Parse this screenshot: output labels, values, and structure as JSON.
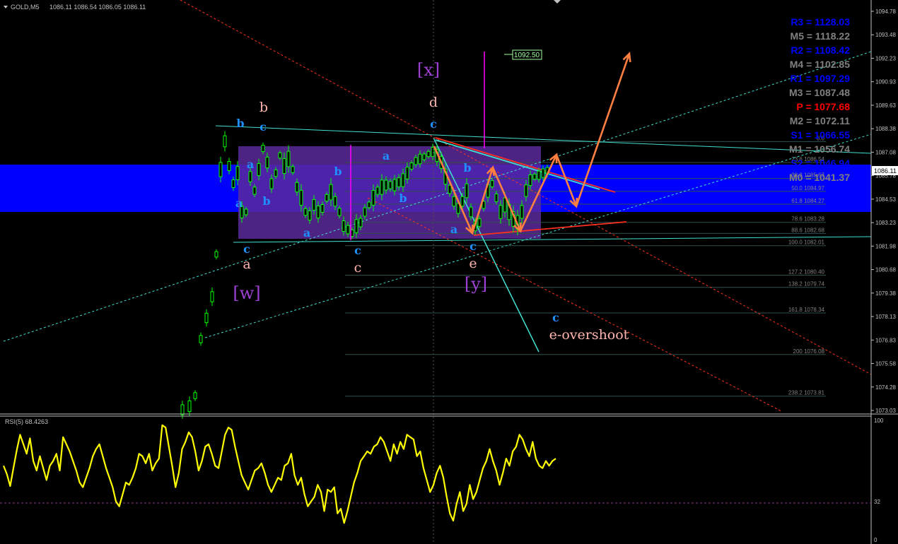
{
  "header": {
    "symbol_label": "GOLD,M5",
    "ohlc": "1086.11 1086.54 1086.05 1086.11"
  },
  "colors": {
    "background": "#000000",
    "axis": "#c0c0c0",
    "grid": "#303030",
    "up_candle": "#00ff00",
    "blue_zone": "#0000ff",
    "purple_box": "#5a2a9a",
    "rsi_line": "#ffff00",
    "rsi_level": "#8b3a8b",
    "fib_line": "#2f4f4f",
    "fib_label": "#808080",
    "wave_blue": "#1e90ff",
    "wave_pink": "#ffb6b0",
    "wave_purple": "#9b40d0",
    "arrow_orange": "#ff7f40",
    "magenta": "#ff00ff",
    "trend_cyan": "#40e0d0",
    "trend_red": "#ff3020"
  },
  "price_axis": {
    "min": 1073.03,
    "max": 1094.78,
    "ticks": [
      "1094.78",
      "1093.48",
      "1092.23",
      "1090.93",
      "1089.63",
      "1088.38",
      "1087.08",
      "1085.78",
      "1084.53",
      "1083.23",
      "1081.98",
      "1080.68",
      "1079.38",
      "1078.13",
      "1076.83",
      "1075.58",
      "1074.28",
      "1073.03"
    ],
    "current_price": "1086.11",
    "marker_price": "1092.50"
  },
  "pivots": [
    {
      "label": "R3 = 1128.03",
      "color": "#0000ff",
      "price": 1128.03
    },
    {
      "label": "M5 = 1118.22",
      "color": "#808080",
      "price": 1118.22
    },
    {
      "label": "R2 = 1108.42",
      "color": "#0000ff",
      "price": 1108.42
    },
    {
      "label": "M4 = 1102.85",
      "color": "#808080",
      "price": 1102.85
    },
    {
      "label": "R1 = 1097.29",
      "color": "#0000ff",
      "price": 1097.29
    },
    {
      "label": "M3 = 1087.48",
      "color": "#808080",
      "price": 1087.48
    },
    {
      "label": "P = 1077.68",
      "color": "#ff0000",
      "price": 1077.68
    },
    {
      "label": "M2 = 1072.11",
      "color": "#808080",
      "price": 1072.11
    },
    {
      "label": "S1 = 1066.55",
      "color": "#0000ff",
      "price": 1066.55
    },
    {
      "label": "M1 = 1056.74",
      "color": "#808080",
      "price": 1056.74
    },
    {
      "label": "S2 = 1046.94",
      "color": "#0000ff",
      "price": 1046.94
    },
    {
      "label": "M0 = 1041.37",
      "color": "#808080",
      "price": 1041.37
    }
  ],
  "fib_levels": [
    {
      "label": "0.0",
      "price": 1087.68
    },
    {
      "label": "23.6 1086.54",
      "price": 1086.54
    },
    {
      "label": "38.2 1085.67",
      "price": 1085.67
    },
    {
      "label": "50.0 1084.97",
      "price": 1084.97
    },
    {
      "label": "61.8 1084.27",
      "price": 1084.27
    },
    {
      "label": "78.6 1083.28",
      "price": 1083.28
    },
    {
      "label": "88.6 1082.68",
      "price": 1082.68
    },
    {
      "label": "100.0 1082.01",
      "price": 1082.01
    },
    {
      "label": "127.2 1080.40",
      "price": 1080.4
    },
    {
      "label": "138.2 1079.74",
      "price": 1079.74
    },
    {
      "label": "161.8 1078.34",
      "price": 1078.34
    },
    {
      "label": "200 1076.08",
      "price": 1076.08
    },
    {
      "label": "238.2 1073.81",
      "price": 1073.81
    }
  ],
  "rsi": {
    "label": "RSI(5) 68.4263",
    "ticks": [
      "100",
      "32",
      "0"
    ],
    "level": 32,
    "values": [
      62,
      55,
      45,
      60,
      75,
      88,
      80,
      72,
      85,
      66,
      58,
      70,
      60,
      50,
      62,
      66,
      72,
      58,
      86,
      80,
      74,
      66,
      58,
      48,
      44,
      52,
      60,
      70,
      76,
      80,
      70,
      60,
      52,
      44,
      32,
      28,
      38,
      48,
      46,
      52,
      60,
      72,
      70,
      64,
      72,
      58,
      64,
      68,
      96,
      94,
      78,
      62,
      44,
      56,
      76,
      82,
      90,
      86,
      74,
      58,
      66,
      78,
      80,
      72,
      62,
      60,
      74,
      88,
      94,
      92,
      78,
      66,
      54,
      48,
      42,
      50,
      58,
      60,
      64,
      56,
      46,
      40,
      46,
      52,
      50,
      62,
      64,
      72,
      54,
      46,
      52,
      38,
      28,
      32,
      36,
      46,
      40,
      24,
      42,
      40,
      44,
      22,
      26,
      14,
      24,
      36,
      48,
      56,
      66,
      70,
      74,
      72,
      78,
      80,
      86,
      82,
      74,
      66,
      80,
      72,
      82,
      76,
      88,
      86,
      84,
      70,
      74,
      60,
      50,
      40,
      46,
      56,
      62,
      52,
      36,
      22,
      16,
      30,
      40,
      24,
      30,
      46,
      34,
      40,
      50,
      60,
      66,
      76,
      66,
      58,
      46,
      56,
      68,
      62,
      74,
      78,
      88,
      84,
      76,
      70,
      82,
      68,
      62,
      60,
      66,
      62,
      66,
      68
    ],
    "last_value": 68.4263
  },
  "wave_labels": [
    {
      "text": "b",
      "class": "blue",
      "pos": [
        340,
        180
      ]
    },
    {
      "text": "c",
      "class": "blue",
      "pos": [
        372,
        185
      ]
    },
    {
      "text": "b",
      "class": "pink",
      "pos": [
        373,
        158
      ]
    },
    {
      "text": "a",
      "class": "blue",
      "pos": [
        354,
        238
      ]
    },
    {
      "text": "a",
      "class": "blue",
      "pos": [
        338,
        293
      ]
    },
    {
      "text": "b",
      "class": "blue",
      "pos": [
        377,
        290
      ]
    },
    {
      "text": "c",
      "class": "blue",
      "pos": [
        349,
        358
      ]
    },
    {
      "text": "a",
      "class": "pink",
      "pos": [
        349,
        380
      ]
    },
    {
      "text": "[w]",
      "class": "purple",
      "pos": [
        349,
        423
      ]
    },
    {
      "text": "a",
      "class": "blue",
      "pos": [
        434,
        335
      ]
    },
    {
      "text": "b",
      "class": "blue",
      "pos": [
        478,
        248
      ]
    },
    {
      "text": "c",
      "class": "blue",
      "pos": [
        506,
        360
      ]
    },
    {
      "text": "c",
      "class": "pink",
      "pos": [
        506,
        385
      ]
    },
    {
      "text": "a",
      "class": "blue",
      "pos": [
        546,
        226
      ]
    },
    {
      "text": "b",
      "class": "blue",
      "pos": [
        570,
        286
      ]
    },
    {
      "text": "[x]",
      "class": "purple",
      "pos": [
        606,
        107
      ]
    },
    {
      "text": "d",
      "class": "pink",
      "pos": [
        613,
        151
      ]
    },
    {
      "text": "c",
      "class": "blue",
      "pos": [
        613,
        181
      ]
    },
    {
      "text": "b",
      "class": "blue",
      "pos": [
        661,
        243
      ]
    },
    {
      "text": "a",
      "class": "blue",
      "pos": [
        642,
        330
      ]
    },
    {
      "text": "c",
      "class": "blue",
      "pos": [
        669,
        354
      ]
    },
    {
      "text": "e",
      "class": "pink",
      "pos": [
        669,
        379
      ]
    },
    {
      "text": "[y]",
      "class": "purple",
      "pos": [
        673,
        410
      ]
    },
    {
      "text": "c",
      "class": "blue",
      "pos": [
        786,
        455
      ]
    },
    {
      "text": "e-overshoot",
      "class": "pink",
      "pos": [
        833,
        480
      ]
    }
  ]
}
